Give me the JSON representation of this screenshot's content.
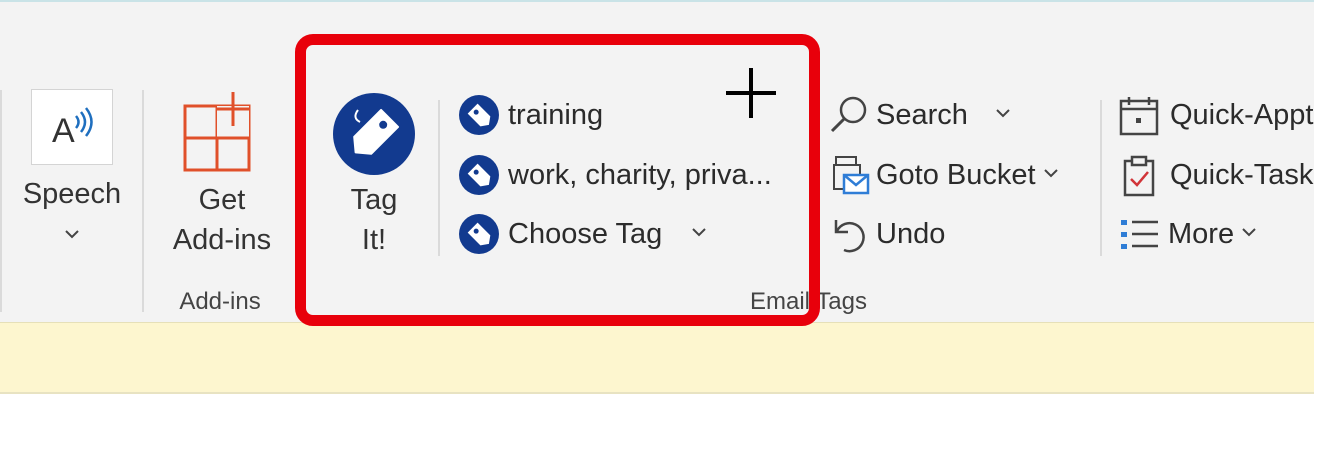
{
  "ribbon": {
    "speech": {
      "label": "Speech"
    },
    "addins": {
      "label_line1": "Get",
      "label_line2": "Add-ins",
      "group_label": "Add-ins"
    },
    "email_tags": {
      "tag_it_line1": "Tag",
      "tag_it_line2": "It!",
      "items": [
        {
          "label": "training"
        },
        {
          "label": "work, charity, priva..."
        },
        {
          "label": "Choose Tag"
        }
      ],
      "group_label": "Email Tags"
    },
    "bucket": {
      "search_label": "Search",
      "goto_label": "Goto Bucket",
      "undo_label": "Undo"
    },
    "quick": {
      "appt_label": "Quick-Appt",
      "task_label": "Quick-Task",
      "more_label": "More"
    }
  },
  "colors": {
    "highlight": "#e8000b",
    "tag_icon": "#123a8f",
    "addin_icon": "#e0502a",
    "infobar": "#fdf6cf"
  },
  "icons": [
    "speech-icon",
    "get-addins-icon",
    "tag-it-icon",
    "tag-icon",
    "search-icon",
    "goto-bucket-icon",
    "undo-icon",
    "calendar-icon",
    "task-icon",
    "list-icon",
    "cursor-crosshair-icon"
  ]
}
